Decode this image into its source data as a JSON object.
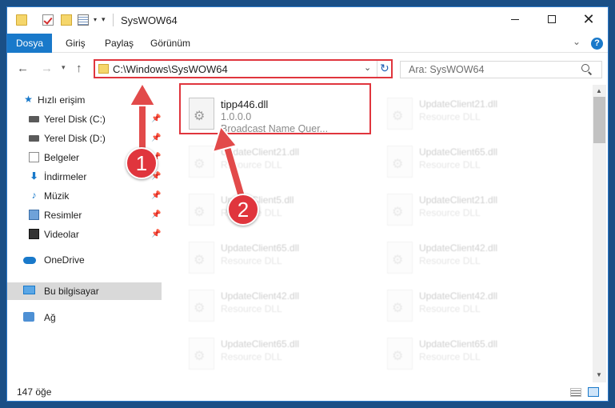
{
  "window": {
    "title": "SysWOW64"
  },
  "ribbon": {
    "tabs": [
      "Dosya",
      "Giriş",
      "Paylaş",
      "Görünüm"
    ],
    "help": "?"
  },
  "nav": {
    "address": "C:\\Windows\\SysWOW64",
    "search_placeholder": "Ara: SysWOW64"
  },
  "sidebar": {
    "quick_access": "Hızlı erişim",
    "items": [
      {
        "label": "Yerel Disk (C:)",
        "icon": "drive-icon"
      },
      {
        "label": "Yerel Disk (D:)",
        "icon": "drive-icon"
      },
      {
        "label": "Belgeler",
        "icon": "documents-icon"
      },
      {
        "label": "İndirmeler",
        "icon": "download-icon"
      },
      {
        "label": "Müzik",
        "icon": "music-icon"
      },
      {
        "label": "Resimler",
        "icon": "pictures-icon"
      },
      {
        "label": "Videolar",
        "icon": "videos-icon"
      }
    ],
    "onedrive": "OneDrive",
    "this_pc": "Bu bilgisayar",
    "network": "Ağ"
  },
  "files": [
    {
      "name": "tipp446.dll",
      "line2": "1.0.0.0",
      "line3": "Broadcast Name Quer..."
    },
    {
      "name": "UpdateClient21.dll",
      "line2": "Resource DLL"
    },
    {
      "name": "UpdateClient21.dll",
      "line2": "Resource DLL"
    },
    {
      "name": "UpdateClient65.dll",
      "line2": "Resource DLL"
    },
    {
      "name": "UpdateClient5.dll",
      "line2": "Resource DLL"
    },
    {
      "name": "UpdateClient21.dll",
      "line2": "Resource DLL"
    },
    {
      "name": "UpdateClient65.dll",
      "line2": "Resource DLL"
    },
    {
      "name": "UpdateClient42.dll",
      "line2": "Resource DLL"
    },
    {
      "name": "UpdateClient42.dll",
      "line2": "Resource DLL"
    },
    {
      "name": "UpdateClient42.dll",
      "line2": "Resource DLL"
    },
    {
      "name": "UpdateClient65.dll",
      "line2": "Resource DLL"
    },
    {
      "name": "UpdateClient65.dll",
      "line2": "Resource DLL"
    }
  ],
  "status": {
    "count": "147 öğe"
  },
  "annotations": {
    "step1": "1",
    "step2": "2",
    "color": "#e0353d"
  }
}
